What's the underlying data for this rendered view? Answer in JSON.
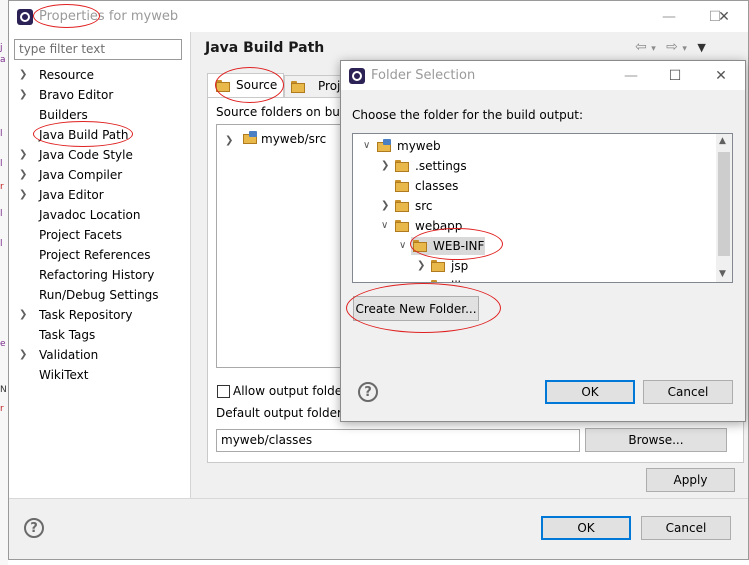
{
  "window": {
    "title": "Properties for myweb",
    "colors": {
      "accent": "#0078d7",
      "highlight_ellipse": "#e02020",
      "folder": "#e8b84a",
      "title_text": "#9a9a9a"
    }
  },
  "sidebar": {
    "filter_placeholder": "type filter text",
    "items": [
      {
        "label": "Resource",
        "expandable": true
      },
      {
        "label": "Bravo Editor",
        "expandable": true
      },
      {
        "label": "Builders",
        "expandable": false
      },
      {
        "label": "Java Build Path",
        "expandable": false,
        "selected": true
      },
      {
        "label": "Java Code Style",
        "expandable": true
      },
      {
        "label": "Java Compiler",
        "expandable": true
      },
      {
        "label": "Java Editor",
        "expandable": true
      },
      {
        "label": "Javadoc Location",
        "expandable": false
      },
      {
        "label": "Project Facets",
        "expandable": false
      },
      {
        "label": "Project References",
        "expandable": false
      },
      {
        "label": "Refactoring History",
        "expandable": false
      },
      {
        "label": "Run/Debug Settings",
        "expandable": false
      },
      {
        "label": "Task Repository",
        "expandable": true
      },
      {
        "label": "Task Tags",
        "expandable": false
      },
      {
        "label": "Validation",
        "expandable": true
      },
      {
        "label": "WikiText",
        "expandable": false
      }
    ]
  },
  "main": {
    "heading": "Java Build Path",
    "tabs": [
      {
        "label": "Source"
      },
      {
        "label": "Proje"
      }
    ],
    "source_folders_label": "Source folders on bui",
    "source_tree": [
      {
        "label": "myweb/src"
      }
    ],
    "allow_output_label": "Allow output folder",
    "default_output_label": "Default output folder:",
    "output_value": "myweb/classes",
    "browse_label": "Browse...",
    "apply_label": "Apply",
    "ok_label": "OK",
    "cancel_label": "Cancel"
  },
  "dialog": {
    "title": "Folder Selection",
    "prompt": "Choose the folder for the build output:",
    "tree": [
      {
        "label": "myweb",
        "depth": 0,
        "state": "expanded",
        "kind": "project"
      },
      {
        "label": ".settings",
        "depth": 1,
        "state": "collapsed",
        "kind": "folder"
      },
      {
        "label": "classes",
        "depth": 1,
        "state": "leaf",
        "kind": "folder"
      },
      {
        "label": "src",
        "depth": 1,
        "state": "collapsed",
        "kind": "folder"
      },
      {
        "label": "webapp",
        "depth": 1,
        "state": "expanded",
        "kind": "folder"
      },
      {
        "label": "WEB-INF",
        "depth": 2,
        "state": "expanded",
        "kind": "folder",
        "selected": true
      },
      {
        "label": "jsp",
        "depth": 3,
        "state": "collapsed",
        "kind": "folder"
      },
      {
        "label": "lib",
        "depth": 3,
        "state": "leaf",
        "kind": "folder"
      }
    ],
    "create_folder_label": "Create New Folder...",
    "ok_label": "OK",
    "cancel_label": "Cancel"
  }
}
